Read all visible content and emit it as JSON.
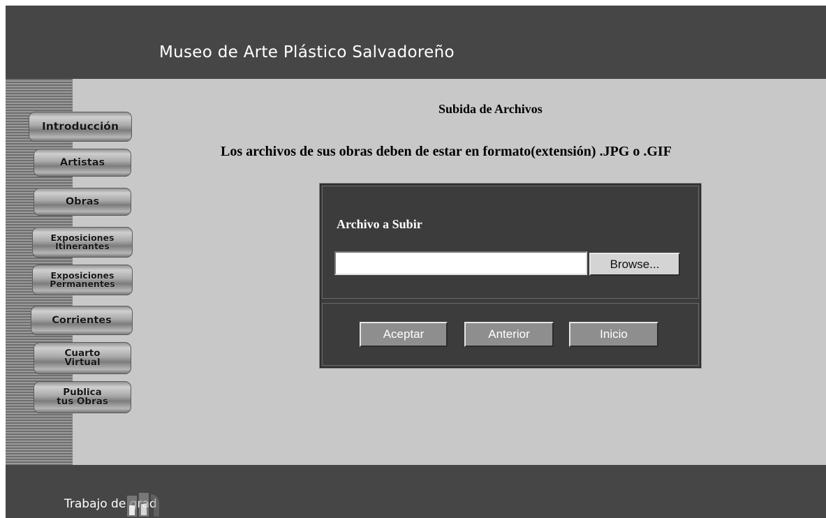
{
  "header": {
    "title": "Museo de Arte Plástico Salvadoreño"
  },
  "sidebar": {
    "items": [
      {
        "label": "Introducción"
      },
      {
        "label": "Artistas"
      },
      {
        "label": "Obras"
      },
      {
        "line1": "Exposiciones",
        "line2": "Itinerantes"
      },
      {
        "line1": "Exposiciones",
        "line2": "Permanentes"
      },
      {
        "label": "Corrientes"
      },
      {
        "line1": "Cuarto",
        "line2": "Virtual"
      },
      {
        "line1": "Publica",
        "line2": "tus Obras"
      }
    ]
  },
  "main": {
    "heading": "Subida de Archivos",
    "instructions": "Los archivos de sus obras deben de estar en formato(extensión) .JPG o .GIF",
    "upload_form": {
      "file_label": "Archivo  a Subir",
      "file_value": "",
      "browse_label": "Browse...",
      "accept_label": "Aceptar",
      "back_label": "Anterior",
      "home_label": "Inicio"
    }
  },
  "footer": {
    "text": "Trabajo de grad"
  },
  "colors": {
    "header_bg": "#464646",
    "content_bg": "#c8c8c8",
    "panel_bg": "#3c3c3c",
    "button_bg": "#8e8e8e"
  }
}
